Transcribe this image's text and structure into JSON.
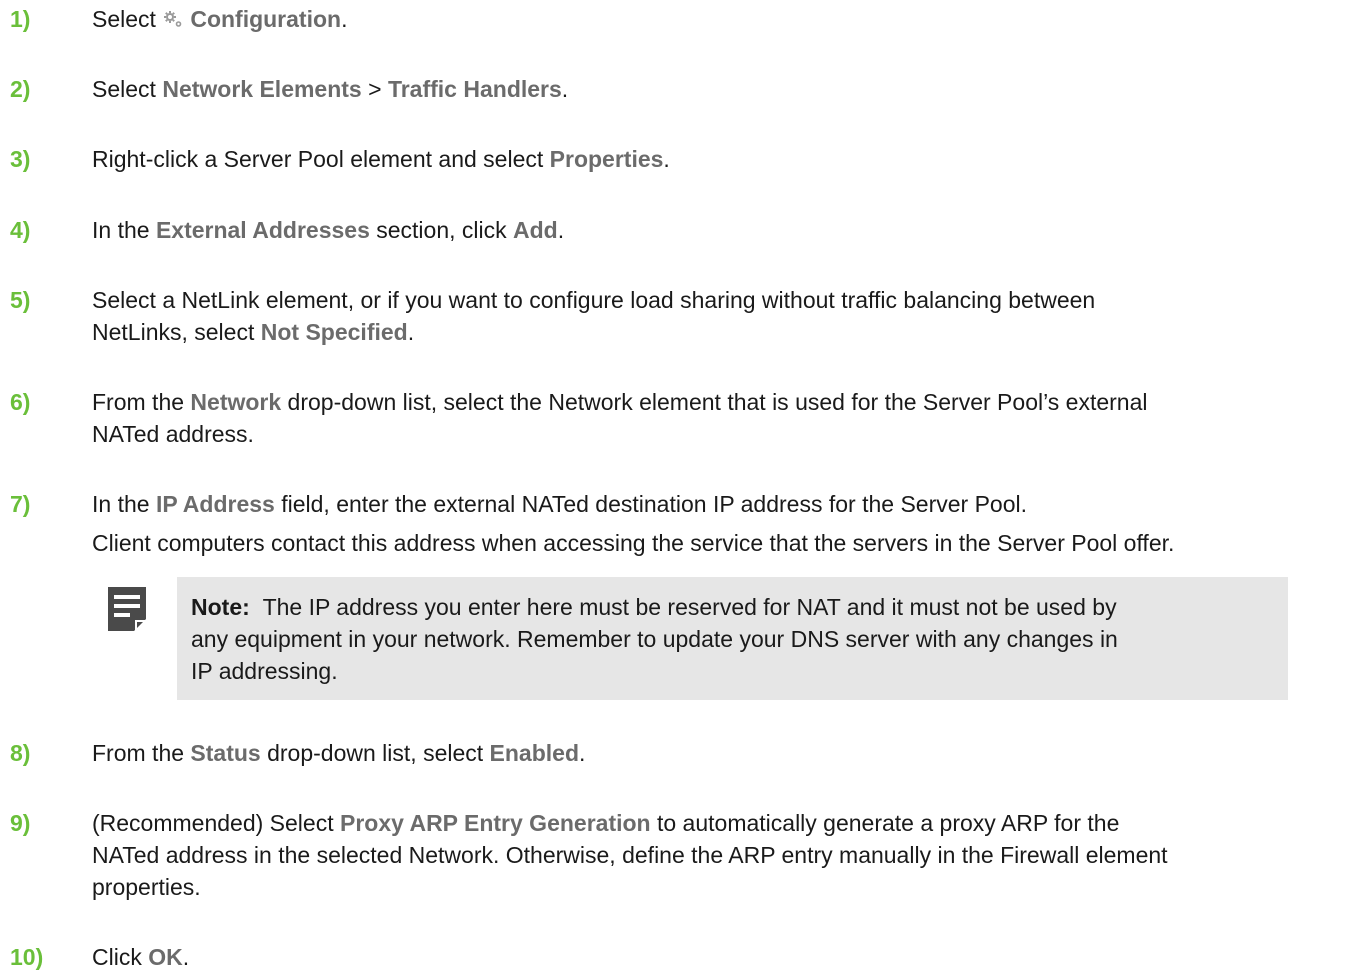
{
  "steps": [
    {
      "num": "1)",
      "parts": [
        "Select ",
        "Configuration",
        "."
      ]
    },
    {
      "num": "2)",
      "parts": [
        "Select ",
        "Network Elements",
        " > ",
        "Traffic Handlers",
        "."
      ]
    },
    {
      "num": "3)",
      "parts": [
        "Right-click a Server Pool element and select ",
        "Properties",
        "."
      ]
    },
    {
      "num": "4)",
      "parts": [
        "In the ",
        "External Addresses",
        " section, click ",
        "Add",
        "."
      ]
    },
    {
      "num": "5)",
      "line1": "Select a NetLink element, or if you want to configure load sharing without traffic balancing between",
      "parts": [
        "NetLinks, select ",
        "Not Specified",
        "."
      ]
    },
    {
      "num": "6)",
      "parts": [
        "From the ",
        "Network",
        " drop-down list, select the Network element that is used for the Server Pool’s external"
      ],
      "line2": "NATed address."
    },
    {
      "num": "7)",
      "parts": [
        "In the ",
        "IP Address",
        " field, enter the external NATed destination IP address for the Server Pool."
      ],
      "sub": "Client computers contact this address when accessing the service that the servers in the Server Pool offer."
    },
    {
      "num": "8)",
      "parts": [
        "From the ",
        "Status",
        " drop-down list, select ",
        "Enabled",
        "."
      ]
    },
    {
      "num": "9)",
      "parts": [
        "(Recommended) Select ",
        "Proxy ARP Entry Generation",
        " to automatically generate a proxy ARP for the"
      ],
      "line2": "NATed address in the selected Network. Otherwise, define the ARP entry manually in the Firewall element",
      "line3": "properties."
    },
    {
      "num": "10)",
      "parts": [
        "Click ",
        "OK",
        "."
      ]
    }
  ],
  "note": {
    "label": "Note:",
    "line1": "The IP address you enter here must be reserved for NAT and it must not be used by",
    "line2": "any equipment in your network. Remember to update your DNS server with any changes in",
    "line3": "IP addressing."
  },
  "icons": {
    "gear": "gear-icon",
    "note": "note-icon"
  },
  "colors": {
    "step_number": "#6abf3a",
    "ui_term": "#6b6b6b",
    "note_background": "#e6e6e6"
  }
}
